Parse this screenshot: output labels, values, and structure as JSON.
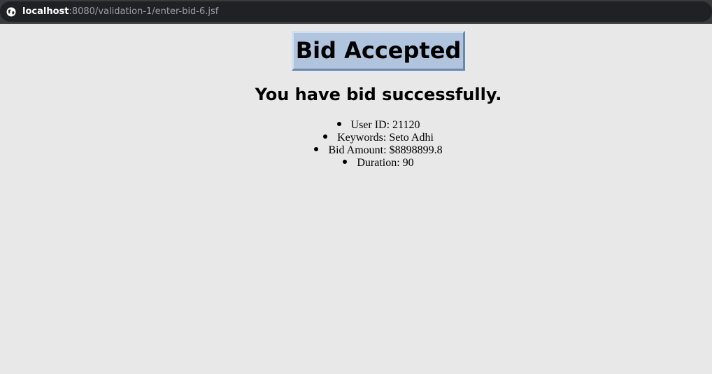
{
  "browser": {
    "url_host": "localhost",
    "url_rest": ":8080/validation-1/enter-bid-6.jsf",
    "site_icon": "globe-icon"
  },
  "page": {
    "title": "Bid Accepted",
    "heading": "You have bid successfully.",
    "details": [
      {
        "label": "User ID: 21120"
      },
      {
        "label": "Keywords: Seto Adhi"
      },
      {
        "label": "Bid Amount: $8898899.8"
      },
      {
        "label": "Duration: 90"
      }
    ]
  },
  "colors": {
    "page_background": "#e8e8e8",
    "title_background": "#b0c4de"
  }
}
